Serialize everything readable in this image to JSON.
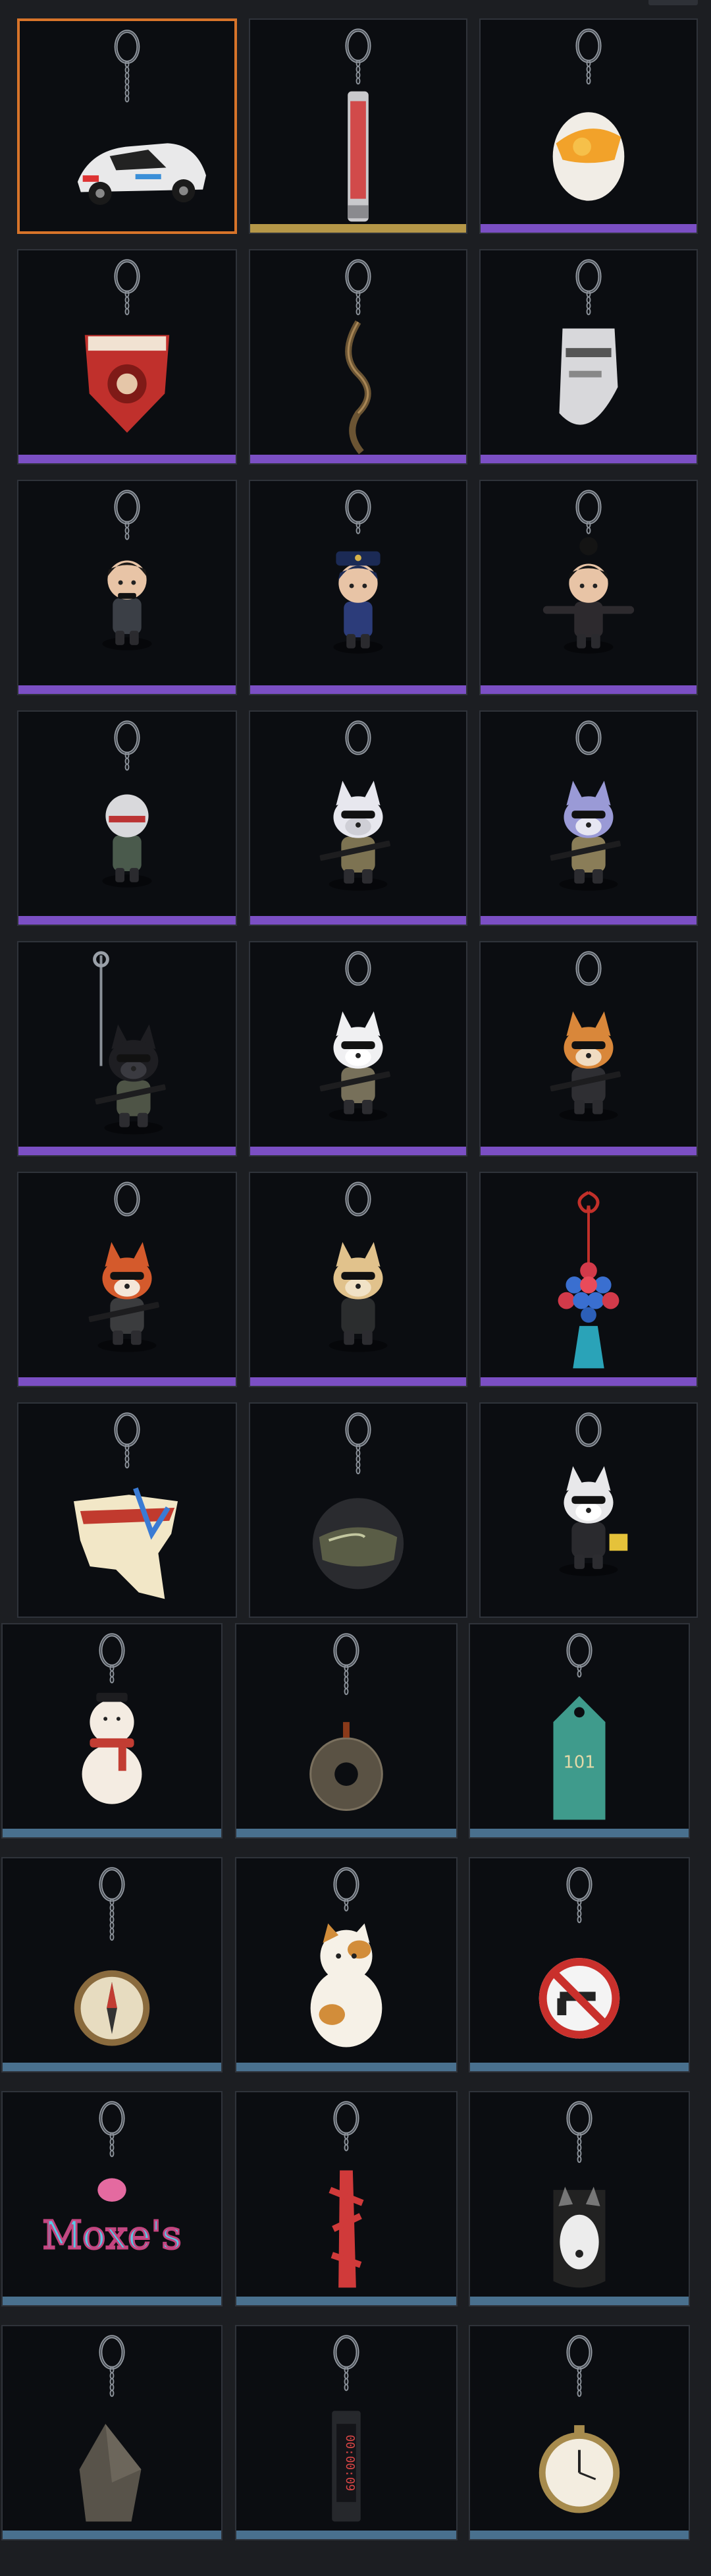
{
  "inventory": {
    "items": [
      {
        "icon": "race-car-charm-icon",
        "rarity": "none",
        "selected": true
      },
      {
        "icon": "red-tube-charm-icon",
        "rarity": "gold"
      },
      {
        "icon": "egg-charm-icon",
        "rarity": "purple"
      },
      {
        "icon": "red-emblem-charm-icon",
        "rarity": "purple"
      },
      {
        "icon": "bronze-chain-charm-icon",
        "rarity": "purple"
      },
      {
        "icon": "silver-mask-charm-icon",
        "rarity": "purple"
      },
      {
        "icon": "suited-figure-charm-icon",
        "rarity": "purple"
      },
      {
        "icon": "police-figure-charm-icon",
        "rarity": "purple"
      },
      {
        "icon": "bun-hair-figure-charm-icon",
        "rarity": "purple"
      },
      {
        "icon": "helmet-soldier-charm-icon",
        "rarity": "purple"
      },
      {
        "icon": "white-wolf-soldier-charm-icon",
        "rarity": "purple"
      },
      {
        "icon": "blue-wolf-soldier-charm-icon",
        "rarity": "purple"
      },
      {
        "icon": "black-cat-rappel-charm-icon",
        "rarity": "purple"
      },
      {
        "icon": "white-cat-soldier-charm-icon",
        "rarity": "purple"
      },
      {
        "icon": "orange-fox-soldier-charm-icon",
        "rarity": "purple"
      },
      {
        "icon": "red-fox-soldier-charm-icon",
        "rarity": "purple"
      },
      {
        "icon": "fennec-soldier-charm-icon",
        "rarity": "purple"
      },
      {
        "icon": "tassel-beads-charm-icon",
        "rarity": "purple"
      },
      {
        "icon": "kamona-map-charm-icon",
        "rarity": "none"
      },
      {
        "icon": "dark-helmet-charm-icon",
        "rarity": "none"
      },
      {
        "icon": "cool-cat-charm-icon",
        "rarity": "none"
      },
      {
        "icon": "snowman-charm-icon",
        "rarity": "blue"
      },
      {
        "icon": "stone-ring-charm-icon",
        "rarity": "blue"
      },
      {
        "icon": "motel-tag-charm-icon",
        "rarity": "blue"
      },
      {
        "icon": "compass-charm-icon",
        "rarity": "blue"
      },
      {
        "icon": "lucky-cat-charm-icon",
        "rarity": "blue"
      },
      {
        "icon": "no-guns-sign-charm-icon",
        "rarity": "blue"
      },
      {
        "icon": "moxes-logo-charm-icon",
        "rarity": "blue"
      },
      {
        "icon": "red-script-charm-icon",
        "rarity": "blue"
      },
      {
        "icon": "husky-tag-charm-icon",
        "rarity": "blue"
      },
      {
        "icon": "rock-shard-charm-icon",
        "rarity": "blue"
      },
      {
        "icon": "digital-timer-charm-icon",
        "rarity": "blue"
      },
      {
        "icon": "pocket-watch-charm-icon",
        "rarity": "blue"
      }
    ]
  },
  "colors": {
    "selected_border": "#d7742a",
    "gold": "#b59748",
    "purple": "#7b4fc4",
    "blue": "#49708e",
    "tile_bg": "#0b0d11"
  }
}
